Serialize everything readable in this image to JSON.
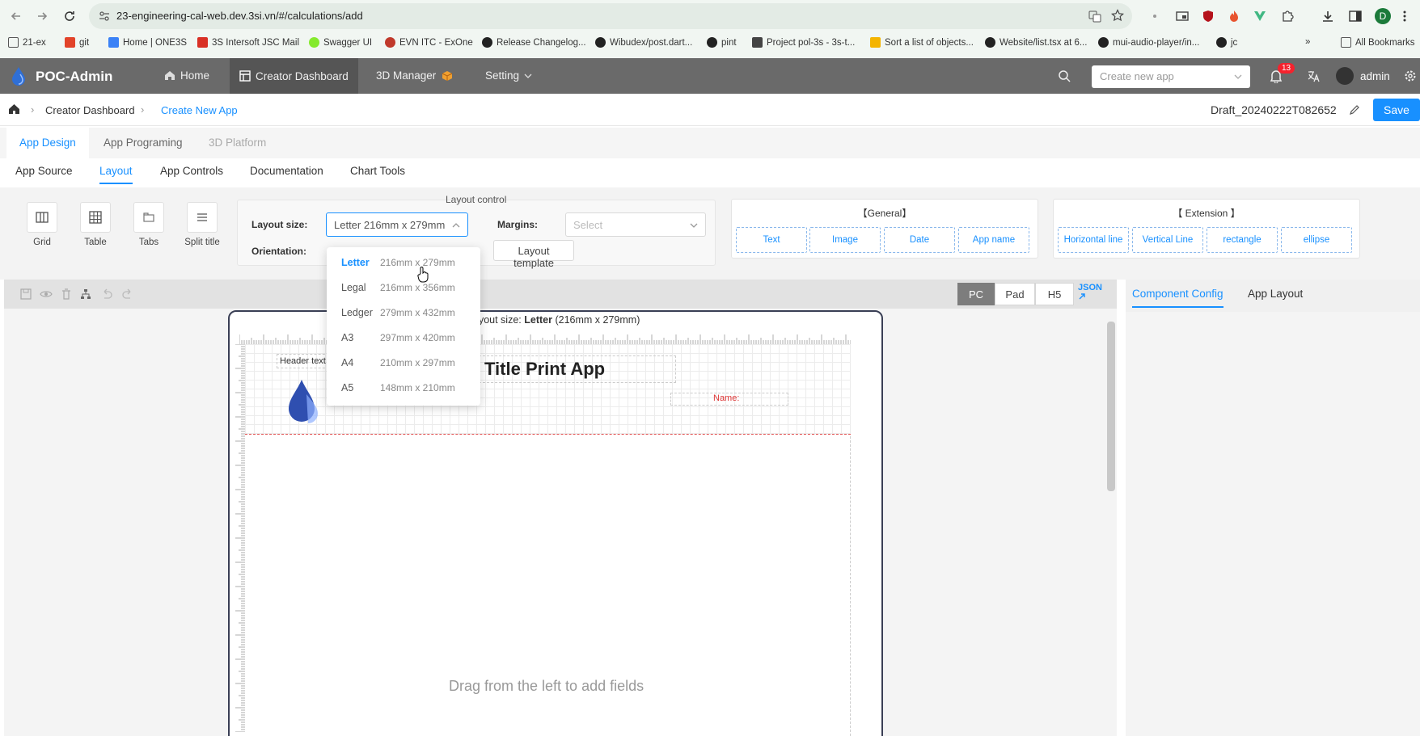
{
  "browser": {
    "url": "23-engineering-cal-web.dev.3si.vn/#/calculations/add",
    "bookmarks": [
      "21-ex",
      "git",
      "Home | ONE3S",
      "3S Intersoft JSC Mail",
      "Swagger UI",
      "EVN ITC - ExOne",
      "Release Changelog...",
      "Wibudex/post.dart...",
      "pint",
      "Project pol-3s - 3s-t...",
      "Sort a list of objects...",
      "Website/list.tsx at 6...",
      "mui-audio-player/in...",
      "jc"
    ],
    "all_bookmarks": "All Bookmarks",
    "profile_initial": "D"
  },
  "header": {
    "brand": "POC-Admin",
    "nav": [
      "Home",
      "Creator Dashboard",
      "3D Manager",
      "Setting"
    ],
    "create_app_placeholder": "Create new app",
    "notifications": "13",
    "user": "admin"
  },
  "breadcrumb": {
    "items": [
      "Creator Dashboard",
      "Create New App"
    ],
    "draft_name": "Draft_20240222T082652",
    "save": "Save"
  },
  "tabs_primary": [
    "App Design",
    "App Programing",
    "3D Platform"
  ],
  "tabs_secondary": [
    "App Source",
    "Layout",
    "App Controls",
    "Documentation",
    "Chart Tools"
  ],
  "tools": [
    "Grid",
    "Table",
    "Tabs",
    "Split title"
  ],
  "layout_control": {
    "title": "Layout control",
    "size_label": "Layout size:",
    "size_value": "Letter 216mm x 279mm",
    "orientation_label": "Orientation:",
    "margins_label": "Margins:",
    "margins_placeholder": "Select",
    "template_button": "Layout template"
  },
  "general": {
    "title": "【General】",
    "items": [
      "Text",
      "Image",
      "Date",
      "App name"
    ]
  },
  "extension": {
    "title": "【 Extension 】",
    "items": [
      "Horizontal line",
      "Vertical Line",
      "rectangle",
      "ellipse"
    ]
  },
  "device_modes": [
    "PC",
    "Pad",
    "H5"
  ],
  "json_label": "JSON",
  "right_panel_tabs": [
    "Component Config",
    "App Layout"
  ],
  "dropdown": [
    {
      "name": "Letter",
      "size": "216mm x 279mm"
    },
    {
      "name": "Legal",
      "size": "216mm x 356mm"
    },
    {
      "name": "Ledger",
      "size": "279mm x 432mm"
    },
    {
      "name": "A3",
      "size": "297mm x 420mm"
    },
    {
      "name": "A4",
      "size": "210mm x 297mm"
    },
    {
      "name": "A5",
      "size": "148mm x 210mm"
    }
  ],
  "canvas": {
    "layout_prefix": "ayout size:",
    "layout_name": "Letter",
    "layout_dims": "(216mm x 279mm)",
    "header_text": "Header text",
    "title": "Title Print App",
    "name_field": "Name:",
    "drop_hint": "Drag from the left to add fields"
  },
  "colors": {
    "accent": "#1890ff",
    "appbar": "#6a6a6a",
    "brand_drop": "#2f6fd6"
  }
}
